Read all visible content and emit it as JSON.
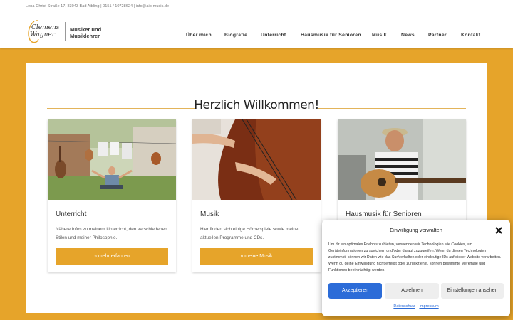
{
  "topbar": {
    "contact": "Lena-Christ-Straße 17, 83043 Bad Aibling | 0151 / 10728624 | info@aib-music.de"
  },
  "logo": {
    "script_line1": "Clemens",
    "script_line2": "Wagner",
    "line1": "Musiker und",
    "line2": "Musiklehrer"
  },
  "nav": [
    "Über mich",
    "Biografie",
    "Unterricht",
    "Hausmusik für Senioren",
    "Musik",
    "News",
    "Partner",
    "Kontakt"
  ],
  "main": {
    "title": "Herzlich Willkommen!"
  },
  "cards": [
    {
      "title": "Unterricht",
      "text": "Nähere Infos zu meinem Unterricht, den verschiedenen Stilen und meiner Philosophie.",
      "button": "» mehr erfahren"
    },
    {
      "title": "Musik",
      "text": "Hier finden sich einige Hörbeispiele sowie meine aktuellen Programme und CDs.",
      "button": "» meine Musik"
    },
    {
      "title": "Hausmusik für Senioren",
      "text": "",
      "button": ""
    }
  ],
  "consent": {
    "title": "Einwilligung verwalten",
    "text": "Um dir ein optimales Erlebnis zu bieten, verwenden wir Technologien wie Cookies, um Geräteinformationen zu speichern und/oder darauf zuzugreifen. Wenn du diesen Technologien zustimmst, können wir Daten wie das Surfverhalten oder eindeutige IDs auf dieser Website verarbeiten. Wenn du deine Einwillligung nicht erteilst oder zurückziehst, können bestimmte Merkmale und Funktionen beeinträchtigt werden.",
    "accept": "Akzeptieren",
    "deny": "Ablehnen",
    "settings": "Einstellungen ansehen",
    "link1": "Datenschutz",
    "link2": "Impressum"
  },
  "colors": {
    "accent": "#e6a42a",
    "consent_primary": "#2c6cd8"
  }
}
